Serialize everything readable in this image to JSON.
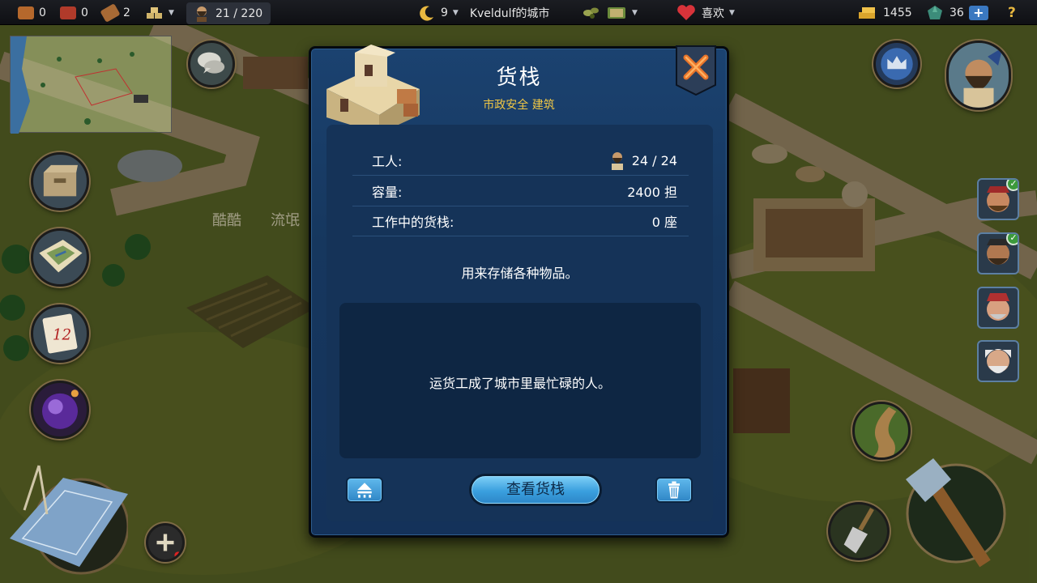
{
  "topbar": {
    "resources": [
      {
        "name": "wood",
        "value": "0",
        "color": "#b5682c"
      },
      {
        "name": "brick",
        "value": "0",
        "color": "#b03a2a"
      },
      {
        "name": "lumber",
        "value": "2",
        "color": "#a86a35"
      }
    ],
    "population": "21 / 220",
    "day": "9",
    "city_name": "Kveldulf的城市",
    "mood": "喜欢",
    "gold": "1455",
    "gems": "36",
    "help": "?"
  },
  "map": {
    "labels": [
      "酷酷",
      "流氓"
    ]
  },
  "dialog": {
    "title": "货栈",
    "subtitle": "市政安全 建筑",
    "stats": [
      {
        "label": "工人:",
        "value": "24 / 24"
      },
      {
        "label": "容量:",
        "value": "2400 担"
      },
      {
        "label": "工作中的货栈:",
        "value": "0 座"
      }
    ],
    "description": "用来存储各种物品。",
    "tip": "运货工成了城市里最忙碌的人。",
    "view_button": "查看货栈"
  },
  "colors": {
    "dialog_bg": "#16375e",
    "accent_gold": "#f2c844",
    "button_blue": "#3a9fde"
  },
  "icons": [
    "wood-icon",
    "brick-icon",
    "lumber-icon",
    "build-icon",
    "worker-icon",
    "moon-icon",
    "olive-icon",
    "book-icon",
    "heart-icon",
    "gold-icon",
    "gem-icon",
    "help-icon",
    "close-icon",
    "upgrade-icon",
    "trash-icon",
    "chat-icon",
    "inventory-icon",
    "world-map-icon",
    "calendar-icon",
    "potion-icon",
    "blueprint-icon",
    "plus-icon",
    "crown-icon",
    "shovel-icon",
    "hammer-icon",
    "road-icon"
  ]
}
